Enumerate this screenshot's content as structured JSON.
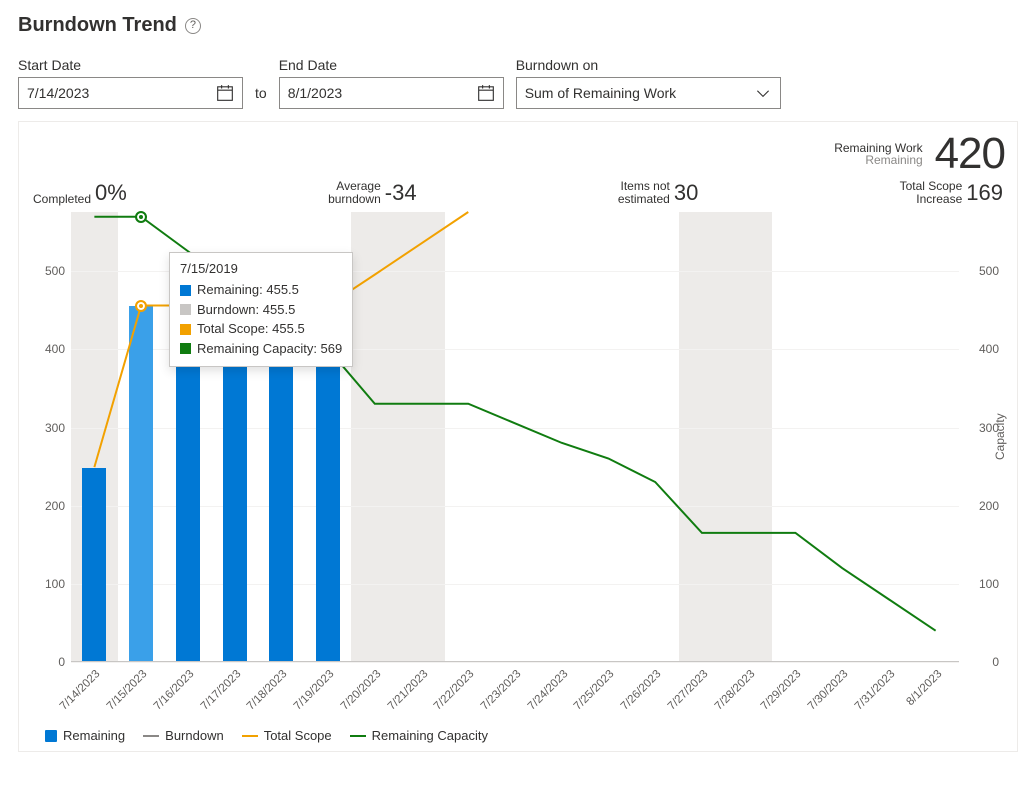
{
  "title": "Burndown Trend",
  "controls": {
    "start_label": "Start Date",
    "start_value": "7/14/2023",
    "to": "to",
    "end_label": "End Date",
    "end_value": "8/1/2023",
    "burndown_on_label": "Burndown on",
    "burndown_on_value": "Sum of Remaining Work"
  },
  "kpi_top": {
    "l1": "Remaining Work",
    "l2": "Remaining",
    "value": "420"
  },
  "kpis": {
    "completed_label": "Completed",
    "completed_value": "0%",
    "avg_label_1": "Average",
    "avg_label_2": "burndown",
    "avg_value": "-34",
    "not_est_label_1": "Items not",
    "not_est_label_2": "estimated",
    "not_est_value": "30",
    "scope_label_1": "Total Scope",
    "scope_label_2": "Increase",
    "scope_value": "169"
  },
  "legend": {
    "remaining": "Remaining",
    "burndown": "Burndown",
    "total_scope": "Total Scope",
    "remaining_capacity": "Remaining Capacity"
  },
  "colors": {
    "remaining": "#0078d4",
    "remaining_hi": "#3aa0e9",
    "burndown": "#8a8886",
    "total_scope": "#f2a100",
    "remaining_capacity": "#107c10",
    "band": "#edebe9"
  },
  "tooltip": {
    "title": "7/15/2019",
    "rows": [
      {
        "key": "remaining",
        "color": "#0078d4",
        "label": "Remaining: 455.5"
      },
      {
        "key": "burndown",
        "color": "#c8c6c4",
        "label": "Burndown: 455.5"
      },
      {
        "key": "total_scope",
        "color": "#f2a100",
        "label": "Total Scope: 455.5"
      },
      {
        "key": "remaining_capacity",
        "color": "#107c10",
        "label": "Remaining Capacity: 569"
      }
    ]
  },
  "y2_title": "Capacity",
  "chart_data": {
    "type": "bar+line",
    "categories": [
      "7/14/2023",
      "7/15/2023",
      "7/16/2023",
      "7/17/2023",
      "7/18/2023",
      "7/19/2023",
      "7/20/2023",
      "7/21/2023",
      "7/22/2023",
      "7/23/2023",
      "7/24/2023",
      "7/25/2023",
      "7/26/2023",
      "7/27/2023",
      "7/28/2023",
      "7/29/2023",
      "7/30/2023",
      "7/31/2023",
      "8/1/2023"
    ],
    "ylim_left": [
      0,
      575
    ],
    "yticks_left": [
      0,
      100,
      200,
      300,
      400,
      500
    ],
    "ylim_right": [
      0,
      575
    ],
    "yticks_right": [
      0,
      100,
      200,
      300,
      400,
      500
    ],
    "series": [
      {
        "name": "Remaining",
        "kind": "bar",
        "color": "#0078d4",
        "values": [
          249,
          455.5,
          400,
          400,
          400,
          420,
          null,
          null,
          null,
          null,
          null,
          null,
          null,
          null,
          null,
          null,
          null,
          null,
          null
        ]
      },
      {
        "name": "Burndown",
        "kind": "band",
        "color": "#c8c6c4",
        "bands": [
          [
            0,
            1
          ],
          [
            6,
            8
          ],
          [
            13,
            15
          ]
        ]
      },
      {
        "name": "Total Scope",
        "kind": "line",
        "color": "#f2a100",
        "values": [
          249,
          455.5,
          455.5,
          455.5,
          455.5,
          455.5,
          495,
          535,
          575,
          null,
          null,
          null,
          null,
          null,
          null,
          null,
          null,
          null,
          null
        ]
      },
      {
        "name": "Remaining Capacity",
        "kind": "line",
        "color": "#107c10",
        "values": [
          569,
          569,
          525,
          480,
          440,
          400,
          330,
          330,
          330,
          305,
          280,
          260,
          230,
          165,
          165,
          165,
          120,
          80,
          40
        ]
      }
    ],
    "highlight_index": 1,
    "highlight_points": [
      {
        "series": "Total Scope",
        "x_index": 1,
        "y": 455.5
      },
      {
        "series": "Remaining Capacity",
        "x_index": 1,
        "y": 569
      }
    ]
  }
}
